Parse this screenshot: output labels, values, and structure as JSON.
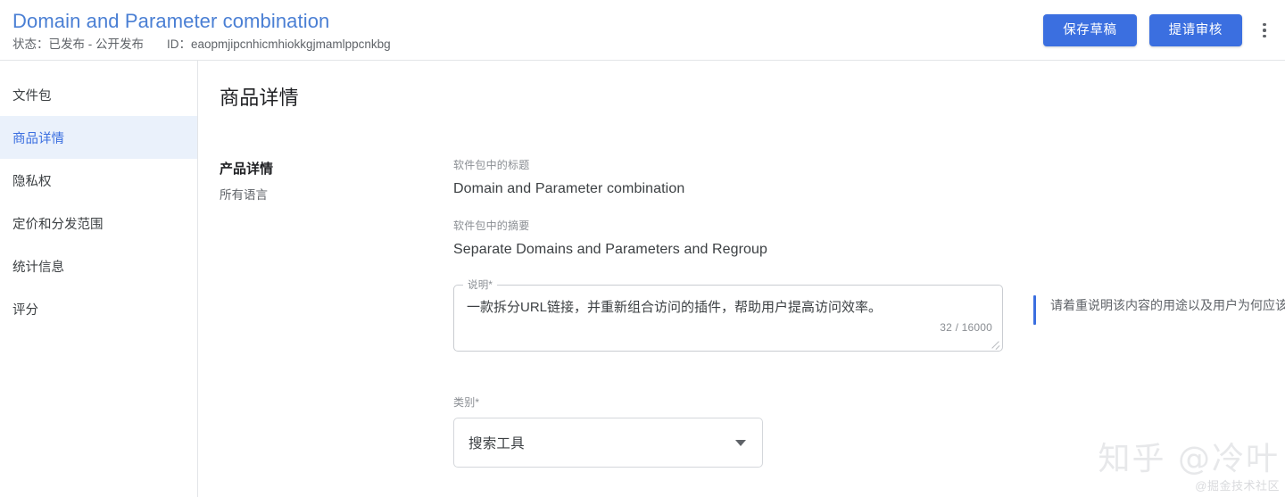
{
  "header": {
    "title": "Domain and Parameter combination",
    "status_label": "状态：",
    "status_value": "已发布 - 公开发布",
    "id_label": "ID：",
    "id_value": "eaopmjipcnhicmhiokkgjmamlppcnkbg",
    "save_draft_label": "保存草稿",
    "submit_review_label": "提请审核",
    "overflow_menu_name": "more-vert-icon",
    "accent_color": "#3b6fe0",
    "title_color": "#4a7fd4"
  },
  "sidebar": {
    "items": [
      {
        "label": "文件包",
        "active": false
      },
      {
        "label": "商品详情",
        "active": true
      },
      {
        "label": "隐私权",
        "active": false
      },
      {
        "label": "定价和分发范围",
        "active": false
      },
      {
        "label": "统计信息",
        "active": false
      },
      {
        "label": "评分",
        "active": false
      }
    ],
    "active_bg": "#eaf1fb",
    "active_color": "#3b6fe0"
  },
  "main": {
    "page_title": "商品详情",
    "section": {
      "aside_title": "产品详情",
      "aside_subtitle": "所有语言",
      "fields": {
        "title": {
          "caption": "软件包中的标题",
          "value": "Domain and Parameter combination"
        },
        "summary": {
          "caption": "软件包中的摘要",
          "value": "Separate Domains and Parameters and Regroup"
        },
        "description": {
          "legend": "说明*",
          "value": "一款拆分URL链接，并重新组合访问的插件，帮助用户提高访问效率。",
          "placeholder": "说明",
          "counter": "32 / 16000",
          "hint": "请着重说明该内容的用途以及用户为何应该安装它",
          "hint_bar_color": "#3b6fe0"
        },
        "category": {
          "caption": "类别*",
          "value": "搜索工具",
          "arrow_icon": "chevron-down-icon"
        }
      }
    },
    "watermark": {
      "main": "知乎 @冷叶",
      "sub": "@掘金技术社区"
    }
  }
}
